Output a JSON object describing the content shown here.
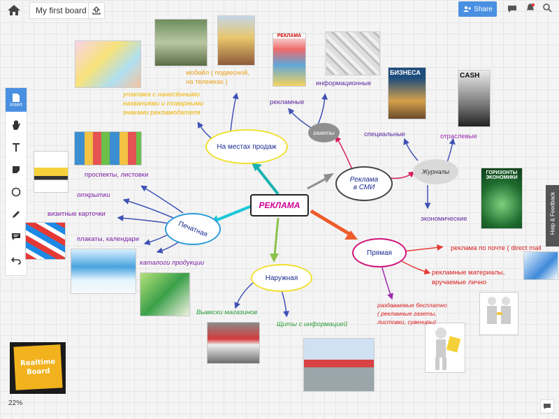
{
  "topbar": {
    "board_title": "My first board",
    "share_label": "Share",
    "home_icon": "home-icon",
    "upload_icon": "upload-icon"
  },
  "toolbar": {
    "insert_label": "Insert",
    "tools": [
      "document-icon",
      "hand-icon",
      "text-icon",
      "sticky-icon",
      "shape-icon",
      "pen-icon",
      "comment-icon",
      "undo-icon"
    ]
  },
  "feedback_label": "Help & Feedback",
  "zoom_label": "22%",
  "sticky": {
    "line1": "Realtime",
    "line2": "Board"
  },
  "colors": {
    "accent": "#4a90e2",
    "center_border": "#222222",
    "center_text": "#cc0099"
  },
  "mindmap": {
    "center": "РЕКЛАМА",
    "places": "На местах продаж",
    "media": "Реклама в СМИ",
    "media_line1": "Реклама",
    "media_line2": "в СМИ",
    "print": "Печатная",
    "outdoor": "Наружная",
    "direct": "Прямая",
    "newspapers": "газеты",
    "journals": "Журналы",
    "mobile_line1": "мобайл ( подвесной,",
    "mobile_line2": "на тележках )",
    "package_line1": "упаковка с нанесёнными",
    "package_line2": "названиями и товарными",
    "package_line3": "знаками рекламодателя",
    "ad_papers": "рекламные",
    "info_papers": "информационные",
    "special": "специальные",
    "industry": "отраслевые",
    "economic": "экономические",
    "prospects": "проспекты, листовки",
    "postcards": "открытки",
    "cards": "визитные карточки",
    "posters": "плакаты, календари",
    "catalogs": "каталоги продукции",
    "shop_signs": "Вывески магазинов",
    "info_boards": "Щиты с информацией",
    "mail": "реклама по почте ( direct mail",
    "handouts_line1": "рекламные материалы,",
    "handouts_line2": "вручаемые лично",
    "free_line1": "раздаваемые бесплатно",
    "free_line2": "( рекламные газеты,",
    "free_line3": "листовки, сувениры)"
  },
  "images": {
    "reklama_paper": "РЕКЛАМА",
    "biznes_mag": "БИЗНЕСА",
    "cash_mag": "CASH",
    "horizons_line1": "ГОРИЗОНТЫ",
    "horizons_line2": "ЭКОНОМИКИ"
  }
}
